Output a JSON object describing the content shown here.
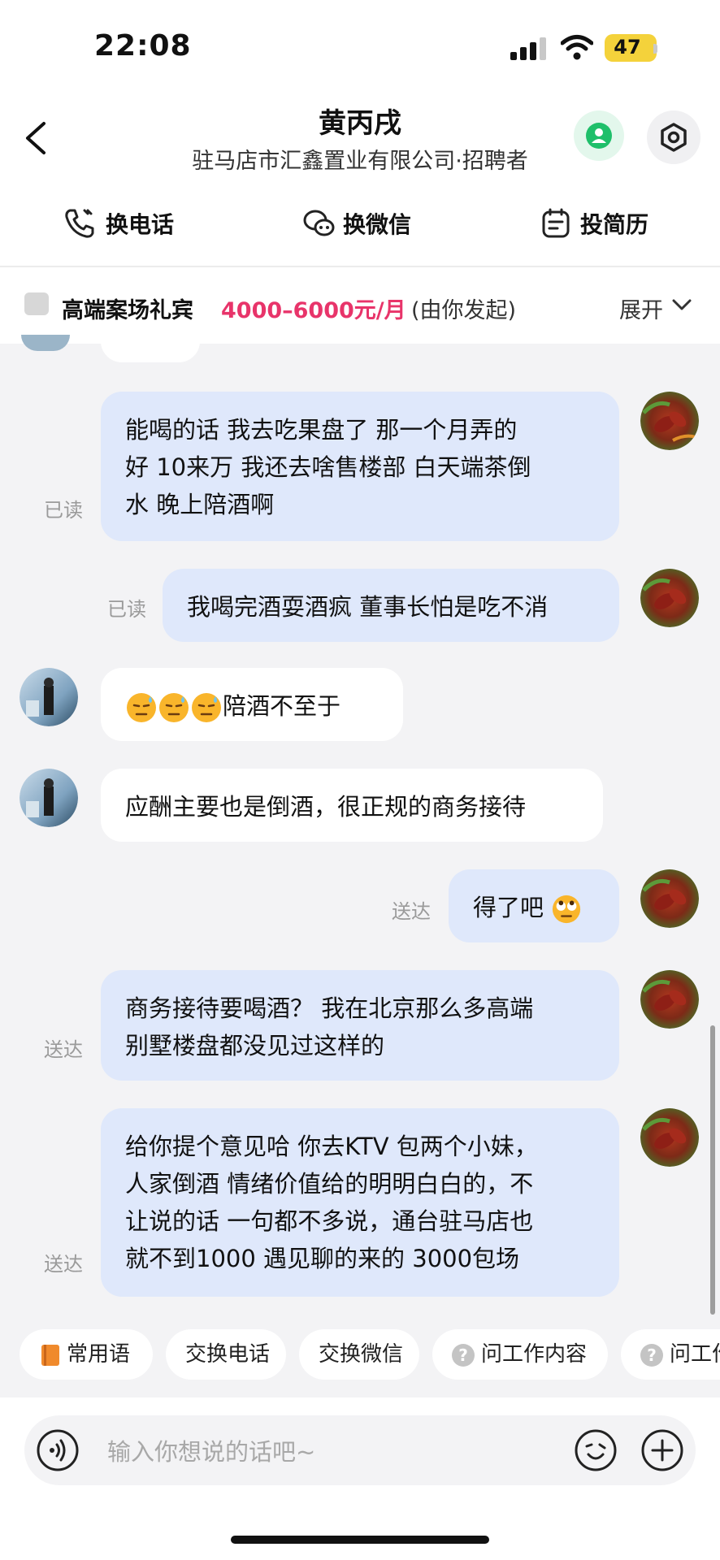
{
  "status_bar": {
    "time": "22:08",
    "battery": "47"
  },
  "header": {
    "name": "黄丙戌",
    "company": "驻马店市汇鑫置业有限公司·招聘者",
    "actions": [
      {
        "label": "换电话",
        "icon": "phone-icon"
      },
      {
        "label": "换微信",
        "icon": "wechat-icon"
      },
      {
        "label": "投简历",
        "icon": "resume-icon"
      }
    ]
  },
  "job_bar": {
    "title": "高端案场礼宾",
    "salary": "4000–6000元/月",
    "initiator": "(由你发起)",
    "expand": "展开"
  },
  "messages": [
    {
      "from": "me",
      "status": "已读",
      "lines": [
        "能喝的话 我去吃果盘了 那一个月弄的",
        "好 10来万 我还去啥售楼部 白天端茶倒",
        "水 晚上陪酒啊"
      ]
    },
    {
      "from": "me",
      "status": "已读",
      "lines": [
        "我喝完酒耍酒疯 董事长怕是吃不消"
      ]
    },
    {
      "from": "them",
      "text": "陪酒不至于",
      "emoji": "downcast-sweat-emoji"
    },
    {
      "from": "them",
      "text": "应酬主要也是倒酒，很正规的商务接待"
    },
    {
      "from": "me",
      "status": "送达",
      "text": "得了吧",
      "emoji": "eye-roll-emoji"
    },
    {
      "from": "me",
      "status": "送达",
      "lines": [
        "商务接待要喝酒？ 我在北京那么多高端",
        "别墅楼盘都没见过这样的"
      ]
    },
    {
      "from": "me",
      "status": "送达",
      "lines": [
        "给你提个意见哈 你去KTV 包两个小妹，",
        "人家倒酒 情绪价值给的明明白白的，不",
        "让说的话 一句都不多说，通台驻马店也",
        "就不到1000 遇见聊的来的 3000包场"
      ]
    }
  ],
  "quick_replies": [
    "常用语",
    "交换电话",
    "交换微信",
    "问工作内容",
    "问工作"
  ],
  "input": {
    "placeholder": "输入你想说的话吧~"
  }
}
